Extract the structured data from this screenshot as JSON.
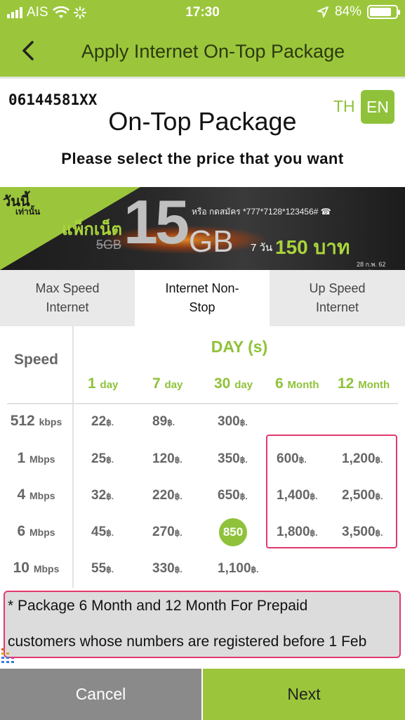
{
  "status_bar": {
    "carrier": "AIS",
    "time": "17:30",
    "battery": "84%"
  },
  "header": {
    "title": "Apply Internet On-Top Package"
  },
  "page": {
    "msisdn": "06144581XX",
    "heading": "On-Top Package",
    "subheading": "Please select the price that you want",
    "lang_th": "TH",
    "lang_en": "EN"
  },
  "banner": {
    "today": "วันนี้",
    "only": "เท่านั้น",
    "pack": "แพ็กเน็ต",
    "old": "5GB",
    "big": "15",
    "unit": "GB",
    "code": "หรือ กดสมัคร *777*7128*123456#",
    "days": "7 วัน",
    "price": "150 บาท",
    "date": "28 ก.พ. 62 เท่านั้น"
  },
  "tabs": [
    {
      "line1": "Max Speed",
      "line2": "Internet"
    },
    {
      "line1": "Internet Non-",
      "line2": "Stop"
    },
    {
      "line1": "Up Speed",
      "line2": "Internet"
    }
  ],
  "table": {
    "speed_header": "Speed",
    "days_header": "DAY (s)",
    "columns": [
      {
        "num": "1",
        "unit": "day"
      },
      {
        "num": "7",
        "unit": "day"
      },
      {
        "num": "30",
        "unit": "day"
      },
      {
        "num": "6",
        "unit": "Month"
      },
      {
        "num": "12",
        "unit": "Month"
      }
    ],
    "rows": [
      {
        "speed": "512",
        "unit": "kbps",
        "prices": [
          "22",
          "89",
          "300",
          "",
          ""
        ]
      },
      {
        "speed": "1",
        "unit": "Mbps",
        "prices": [
          "25",
          "120",
          "350",
          "600",
          "1,200"
        ]
      },
      {
        "speed": "4",
        "unit": "Mbps",
        "prices": [
          "32",
          "220",
          "650",
          "1,400",
          "2,500"
        ]
      },
      {
        "speed": "6",
        "unit": "Mbps",
        "prices": [
          "45",
          "270",
          "850",
          "1,800",
          "3,500"
        ]
      },
      {
        "speed": "10",
        "unit": "Mbps",
        "prices": [
          "55",
          "330",
          "1,100",
          "",
          ""
        ]
      }
    ],
    "currency": "฿.",
    "selected_price": "850"
  },
  "note": {
    "line1": "* Package 6 Month and 12 Month For Prepaid",
    "line2": "customers whose numbers are registered before 1 Feb"
  },
  "buttons": {
    "cancel": "Cancel",
    "next": "Next"
  },
  "colors": {
    "brand_green": "#9bc63b",
    "accent_green": "#8fc23a",
    "highlight": "#e23a6e",
    "cancel_gray": "#8a8a8a"
  }
}
